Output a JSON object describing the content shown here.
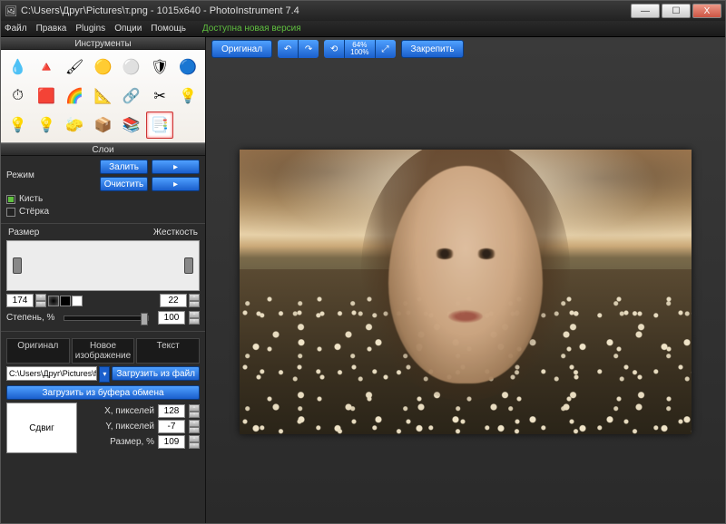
{
  "titlebar": {
    "title": "C:\\Users\\Друг\\Pictures\\т.png - 1015x640 - PhotoInstrument 7.4",
    "min": "—",
    "max": "☐",
    "close": "X"
  },
  "menu": {
    "file": "Файл",
    "edit": "Правка",
    "plugins": "Plugins",
    "options": "Опции",
    "help": "Помощь",
    "update": "Доступна новая версия"
  },
  "toolbar": {
    "original": "Оригинал",
    "undo": "↶",
    "redo": "↷",
    "reset": "⟲",
    "zoom_top": "64%",
    "zoom_bottom": "100%",
    "fit": "⤢",
    "apply": "Закрепить"
  },
  "panels": {
    "tools_title": "Инструменты",
    "layers_title": "Слои",
    "tool_icons": [
      "💧",
      "🔺",
      "🖌",
      "🟡",
      "⚪",
      "🛡",
      "🔵",
      "⏱",
      "🟥",
      "🌈",
      "📐",
      "🔗",
      "✂",
      "💡",
      "💡",
      "💡",
      "🧽",
      "📦",
      "📚",
      "📑"
    ]
  },
  "mode": {
    "label": "Режим",
    "brush": "Кисть",
    "eraser": "Стёрка",
    "fill": "Залить",
    "clear": "Очистить"
  },
  "brush": {
    "size_label": "Размер",
    "hardness_label": "Жесткость",
    "size_value": "174",
    "hardness_value": "22",
    "opacity_label": "Степень, %",
    "opacity_value": "100"
  },
  "tabs": {
    "original": "Оригинал",
    "newimg": "Новое изображение",
    "text": "Текст"
  },
  "image": {
    "path": "C:\\Users\\Друг\\Pictures\\foto na",
    "load_file": "Загрузить из файл",
    "load_clipboard": "Загрузить из буфера обмена",
    "shift": "Сдвиг",
    "x_label": "X, пикселей",
    "x_value": "128",
    "y_label": "Y, пикселей",
    "y_value": "-7",
    "size_label": "Размер, %",
    "size_value": "109"
  }
}
